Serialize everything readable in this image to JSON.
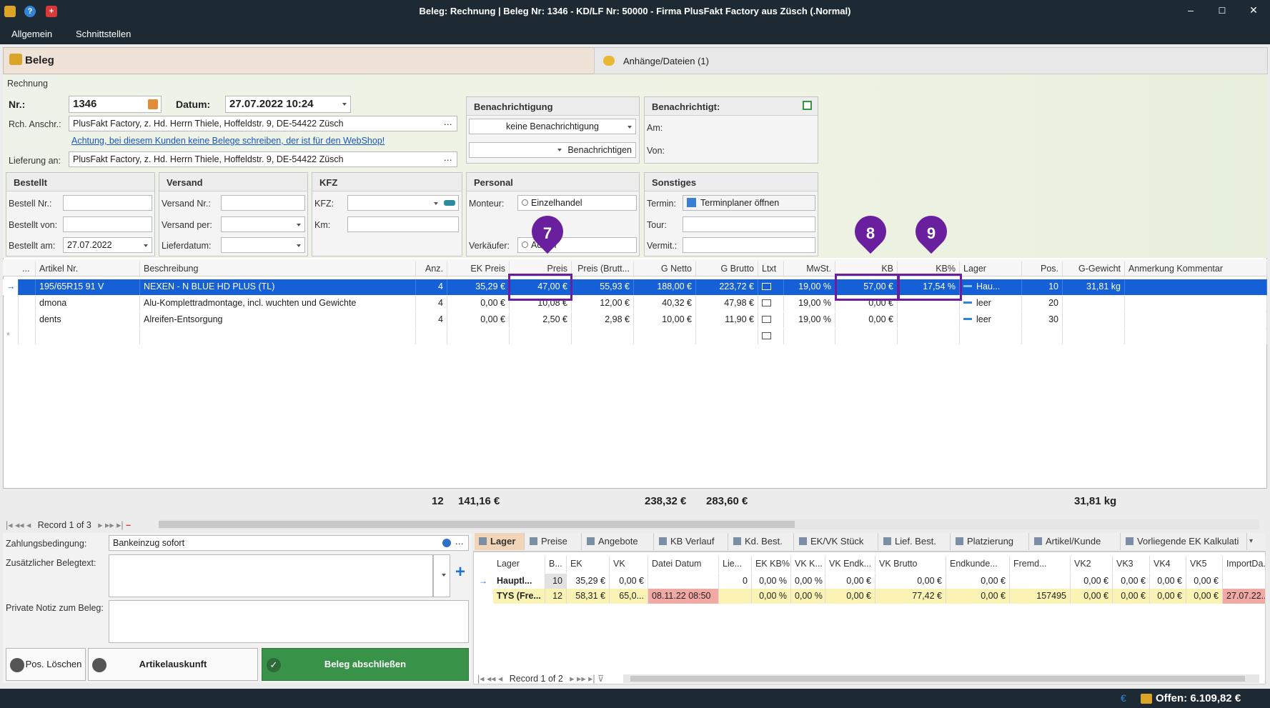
{
  "window": {
    "title": "Beleg: Rechnung | Beleg Nr: 1346 -  KD/LF Nr: 50000 - Firma PlusFakt Factory  aus Züsch (.Normal)"
  },
  "menu": {
    "items": [
      "Allgemein",
      "Schnittstellen"
    ]
  },
  "tabs": {
    "beleg": "Beleg",
    "anhaenge": "Anhänge/Dateien (1)"
  },
  "form": {
    "section": "Rechnung",
    "nr_label": "Nr.:",
    "nr_value": "1346",
    "datum_label": "Datum:",
    "datum_value": "27.07.2022 10:24",
    "rch_label": "Rch. Anschr.:",
    "rch_value": "PlusFakt Factory, z. Hd. Herrn Thiele, Hoffeldstr. 9,  DE-54422 Züsch",
    "warning_link": "Achtung, bei diesem Kunden keine Belege schreiben, der ist für den WebShop!",
    "lieferung_label": "Lieferung an:",
    "lieferung_value": "PlusFakt Factory, z. Hd. Herrn Thiele, Hoffeldstr. 9,  DE-54422 Züsch",
    "benachrichtigung_title": "Benachrichtigung",
    "benachrichtigung_value": "keine Benachrichtigung",
    "benachrichtigen_btn": "Benachrichtigen",
    "benachrichtigt_title": "Benachrichtigt:",
    "am_label": "Am:",
    "von_label": "Von:",
    "bestellt": {
      "title": "Bestellt",
      "nr_label": "Bestell Nr.:",
      "von_label": "Bestellt von:",
      "am_label": "Bestellt am:",
      "am_value": "27.07.2022"
    },
    "versand": {
      "title": "Versand",
      "nr_label": "Versand Nr.:",
      "per_label": "Versand per:",
      "liefer_label": "Lieferdatum:"
    },
    "kfz": {
      "title": "KFZ",
      "kfz_label": "KFZ:",
      "km_label": "Km:"
    },
    "personal": {
      "title": "Personal",
      "monteur_label": "Monteur:",
      "monteur_value": "Einzelhandel",
      "verkaeufer_label": "Verkäufer:",
      "verkaeufer_value": "Admin"
    },
    "sonstiges": {
      "title": "Sonstiges",
      "termin_label": "Termin:",
      "termin_value": "Terminplaner öffnen",
      "tour_label": "Tour:",
      "vermit_label": "Vermit.:"
    }
  },
  "grid": {
    "columns": [
      "...",
      "Artikel Nr.",
      "Beschreibung",
      "Anz.",
      "EK Preis",
      "Preis",
      "Preis (Brutt...",
      "G Netto",
      "G Brutto",
      "Ltxt",
      "MwSt.",
      "KB",
      "KB%",
      "Lager",
      "Pos.",
      "G-Gewicht",
      "Anmerkung Kommentar"
    ],
    "rows": [
      {
        "artikel": "195/65R15 91 V",
        "beschreibung": "NEXEN - N BLUE HD PLUS (TL)",
        "anz": "4",
        "ek": "35,29 €",
        "preis": "47,00 €",
        "brutto": "55,93 €",
        "gnetto": "188,00 €",
        "gbrutto": "223,72 €",
        "mwst": "19,00 %",
        "kb": "57,00 €",
        "kbp": "17,54 %",
        "lager": "Hau...",
        "pos": "10",
        "gewicht": "31,81 kg"
      },
      {
        "artikel": "dmona",
        "beschreibung": "Alu-Komplettradmontage, incl. wuchten und Gewichte",
        "anz": "4",
        "ek": "0,00 €",
        "preis": "10,08 €",
        "brutto": "12,00 €",
        "gnetto": "40,32 €",
        "gbrutto": "47,98 €",
        "mwst": "19,00 %",
        "kb": "0,00 €",
        "kbp": "",
        "lager": "leer",
        "pos": "20",
        "gewicht": ""
      },
      {
        "artikel": "dents",
        "beschreibung": "Alreifen-Entsorgung",
        "anz": "4",
        "ek": "0,00 €",
        "preis": "2,50 €",
        "brutto": "2,98 €",
        "gnetto": "10,00 €",
        "gbrutto": "11,90 €",
        "mwst": "19,00 %",
        "kb": "0,00 €",
        "kbp": "",
        "lager": "leer",
        "pos": "30",
        "gewicht": ""
      }
    ],
    "totals": {
      "anz": "12",
      "ek": "141,16 €",
      "gnetto": "238,32 €",
      "gbrutto": "283,60 €",
      "gewicht": "31,81 kg"
    },
    "record_nav": "Record 1 of 3"
  },
  "callouts": [
    "7",
    "8",
    "9"
  ],
  "bottom": {
    "zahlung_label": "Zahlungsbedingung:",
    "zahlung_value": "Bankeinzug sofort",
    "zusatz_label": "Zusätzlicher Belegtext:",
    "notiz_label": "Private Notiz zum Beleg:",
    "pos_loeschen": "Pos. Löschen",
    "artikelauskunft": "Artikelauskunft",
    "abschliessen": "Beleg abschließen"
  },
  "subtabs": [
    "Lager",
    "Preise",
    "Angebote",
    "KB Verlauf",
    "Kd. Best.",
    "EK/VK Stück",
    "Lief. Best.",
    "Platzierung",
    "Artikel/Kunde",
    "Vorliegende EK Kalkulati"
  ],
  "subgrid": {
    "columns": [
      "Lager",
      "B...",
      "EK",
      "VK",
      "Datei Datum",
      "Lie...",
      "EK KB%",
      "VK K...",
      "VK Endk...",
      "VK Brutto",
      "Endkunde...",
      "Fremd...",
      "VK2",
      "VK3",
      "VK4",
      "VK5",
      "ImportDa..."
    ],
    "rows": [
      [
        "Hauptl...",
        "10",
        "35,29 €",
        "0,00 €",
        "",
        "0",
        "0,00 %",
        "0,00 %",
        "0,00 €",
        "0,00 €",
        "0,00 €",
        "",
        "0,00 €",
        "0,00 €",
        "0,00 €",
        "0,00 €",
        ""
      ],
      [
        "TYS (Fre...",
        "12",
        "58,31 €",
        "65,0...",
        "08.11.22 08:50",
        "",
        "0,00 %",
        "0,00 %",
        "0,00 €",
        "77,42 €",
        "0,00 €",
        "157495",
        "0,00 €",
        "0,00 €",
        "0,00 €",
        "0,00 €",
        "27.07.22..."
      ]
    ],
    "record_nav": "Record 1 of 2"
  },
  "status": {
    "offen": "Offen: 6.109,82 €"
  },
  "colors": {
    "selection": "#1560d6",
    "callout": "#6a1f9e",
    "green": "#389348",
    "titlebar": "#1e2a33"
  }
}
